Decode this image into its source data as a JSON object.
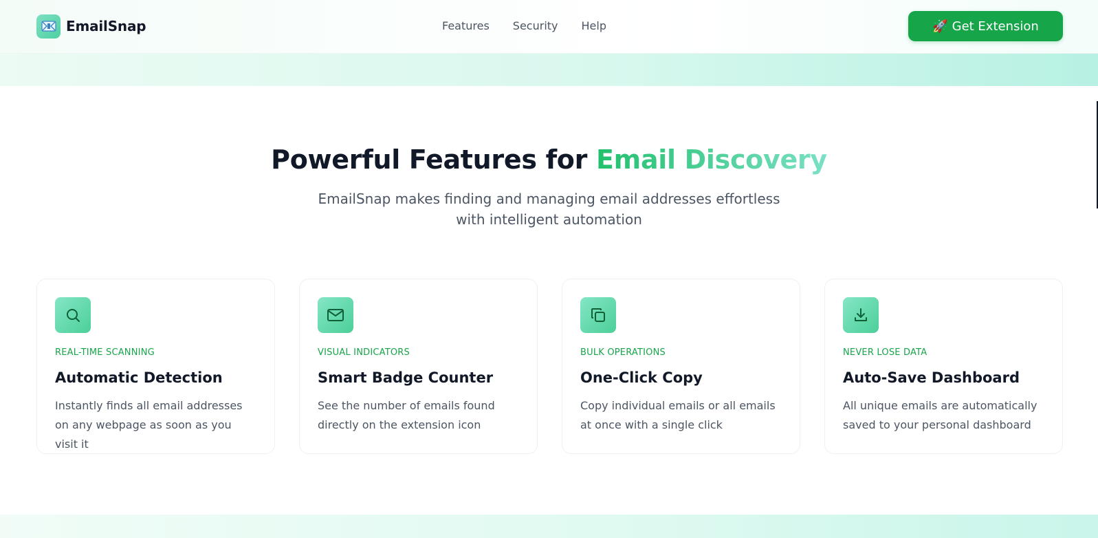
{
  "header": {
    "brand_name": "EmailSnap",
    "logo_icon": "email-extension-logo-icon",
    "nav": [
      "Features",
      "Security",
      "Help"
    ],
    "cta_label": "Get Extension",
    "cta_icon": "🚀"
  },
  "features": {
    "title_main": "Powerful Features for",
    "title_accent": "Email Discovery",
    "subtitle": "EmailSnap makes finding and managing email addresses effortless with intelligent automation",
    "cards": [
      {
        "icon": "search-icon",
        "tag": "REAL-TIME SCANNING",
        "title": "Automatic Detection",
        "description": "Instantly finds all email addresses on any webpage as soon as you visit it"
      },
      {
        "icon": "mail-icon",
        "tag": "VISUAL INDICATORS",
        "title": "Smart Badge Counter",
        "description": "See the number of emails found directly on the extension icon"
      },
      {
        "icon": "copy-icon",
        "tag": "BULK OPERATIONS",
        "title": "One-Click Copy",
        "description": "Copy individual emails or all emails at once with a single click"
      },
      {
        "icon": "download-icon",
        "tag": "NEVER LOSE DATA",
        "title": "Auto-Save Dashboard",
        "description": "All unique emails are automatically saved to your personal dashboard"
      }
    ]
  },
  "colors": {
    "brand_green": "#17a54a",
    "accent_gradient_start": "#22c06c",
    "accent_gradient_end": "#7be0c6"
  }
}
